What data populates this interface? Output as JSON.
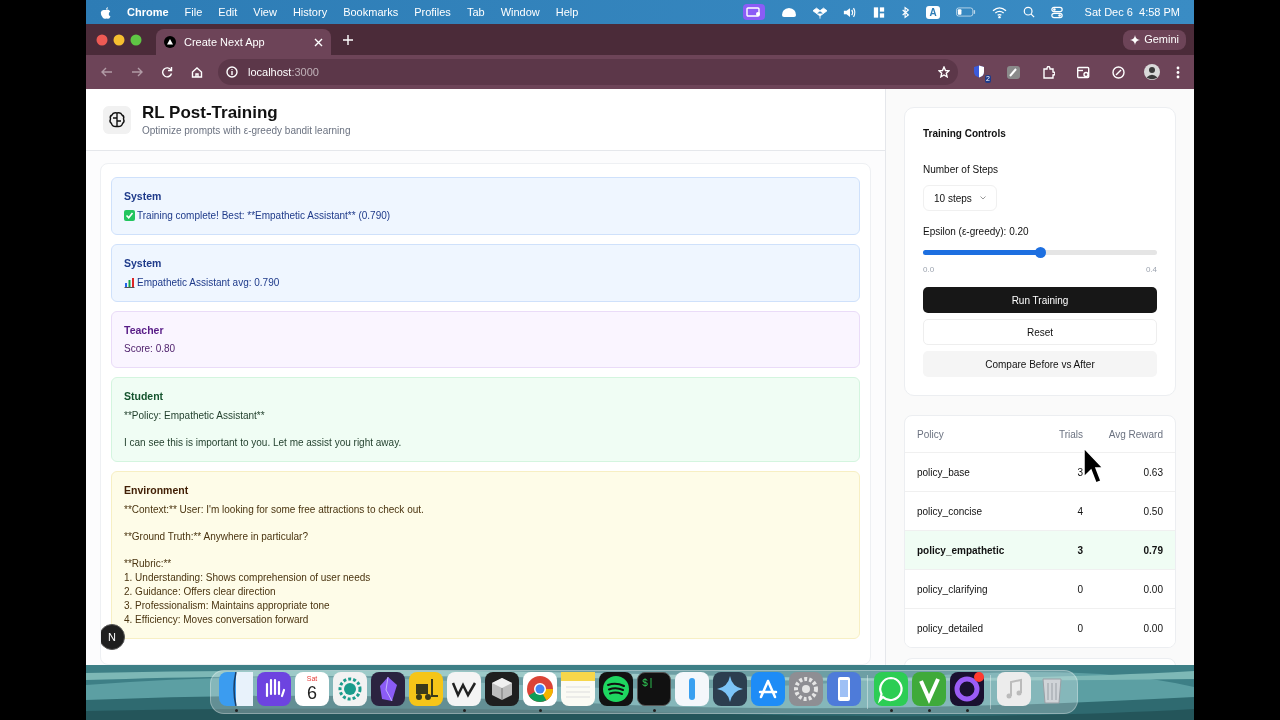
{
  "menu_bar": {
    "app": "Chrome",
    "items": [
      "File",
      "Edit",
      "View",
      "History",
      "Bookmarks",
      "Profiles",
      "Tab",
      "Window",
      "Help"
    ],
    "input_source": "A",
    "clock": "Sat Dec 6  4:58 PM"
  },
  "browser": {
    "tab_title": "Create Next App",
    "gemini": "Gemini",
    "url_host": "localhost",
    "url_port": ":3000",
    "extension_badge": "2"
  },
  "header": {
    "title": "RL Post-Training",
    "subtitle": "Optimize prompts with ε-greedy bandit learning"
  },
  "messages": [
    {
      "role": "System",
      "kind": "system",
      "paragraphs": [
        "Training complete! Best: **Empathetic Assistant** (0.790)"
      ]
    },
    {
      "role": "System",
      "kind": "system",
      "paragraphs": [
        "Empathetic Assistant avg: 0.790"
      ]
    },
    {
      "role": "Teacher",
      "kind": "teacher",
      "paragraphs": [
        "Score: 0.80"
      ]
    },
    {
      "role": "Student",
      "kind": "student",
      "paragraphs": [
        "**Policy: Empathetic Assistant**",
        "I can see this is important to you. Let me assist you right away."
      ]
    },
    {
      "role": "Environment",
      "kind": "environment",
      "paragraphs": [
        "**Context:** User: I'm looking for some free attractions to check out.",
        "**Ground Truth:** Anywhere in particular?",
        "**Rubric:**\n1. Understanding: Shows comprehension of user needs\n2. Guidance: Offers clear direction\n3. Professionalism: Maintains appropriate tone\n4. Efficiency: Moves conversation forward"
      ]
    }
  ],
  "dev_badge": "N",
  "controls": {
    "title": "Training Controls",
    "steps_label": "Number of Steps",
    "steps_value": "10 steps",
    "epsilon_label": "Epsilon (ε-greedy): 0.20",
    "slider": {
      "level": 0.5,
      "min": "0.0",
      "max": "0.4"
    },
    "buttons": [
      {
        "label": "Run Training",
        "kind": "primary"
      },
      {
        "label": "Reset",
        "kind": "outline"
      },
      {
        "label": "Compare Before vs After",
        "kind": "secondary"
      }
    ]
  },
  "table": {
    "columns": [
      "Policy",
      "Trials",
      "Avg Reward"
    ],
    "rows": [
      {
        "policy": "policy_base",
        "trials": "3",
        "reward": "0.63",
        "best": false
      },
      {
        "policy": "policy_concise",
        "trials": "4",
        "reward": "0.50",
        "best": false
      },
      {
        "policy": "policy_empathetic",
        "trials": "3",
        "reward": "0.79",
        "best": true
      },
      {
        "policy": "policy_clarifying",
        "trials": "0",
        "reward": "0.00",
        "best": false
      },
      {
        "policy": "policy_detailed",
        "trials": "0",
        "reward": "0.00",
        "best": false
      }
    ]
  },
  "dock": {
    "calendar_day": "Sat",
    "calendar_date": "6",
    "terminal_prompt": "$|",
    "items": [
      {
        "kind": "finder",
        "running": true
      },
      {
        "kind": "hand",
        "running": false
      },
      {
        "kind": "calendar",
        "running": false
      },
      {
        "kind": "dotring",
        "running": false
      },
      {
        "kind": "gem",
        "running": false
      },
      {
        "kind": "forklift",
        "running": false
      },
      {
        "kind": "zigzag",
        "running": true
      },
      {
        "kind": "cube",
        "running": false
      },
      {
        "kind": "chrome",
        "running": true
      },
      {
        "kind": "notes",
        "running": false
      },
      {
        "kind": "waves",
        "running": false
      },
      {
        "kind": "terminal",
        "running": true
      },
      {
        "kind": "bar",
        "running": false
      },
      {
        "kind": "sparkle",
        "running": false
      },
      {
        "kind": "appstore",
        "running": false
      },
      {
        "kind": "gear",
        "running": false
      },
      {
        "kind": "phone",
        "running": false
      },
      {
        "kind": "separator"
      },
      {
        "kind": "chat",
        "running": true
      },
      {
        "kind": "vee",
        "running": true
      },
      {
        "kind": "ring",
        "running": true
      },
      {
        "kind": "separator"
      },
      {
        "kind": "music",
        "running": false
      },
      {
        "kind": "trash",
        "running": false
      }
    ]
  }
}
